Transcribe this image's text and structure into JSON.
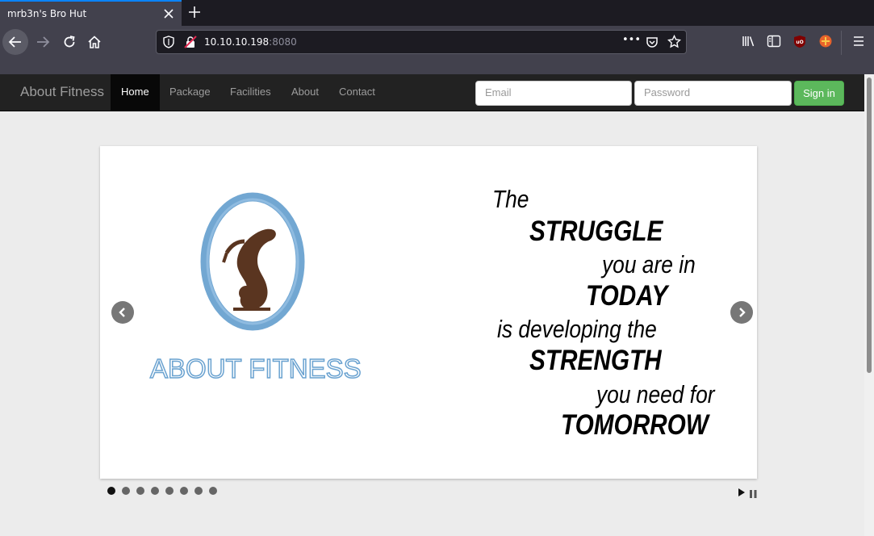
{
  "browser": {
    "tab_title": "mrb3n's Bro Hut",
    "url_host": "10.10.10.198",
    "url_port": ":8080",
    "url_more": "•••"
  },
  "site": {
    "brand": "About Fitness",
    "menu": [
      {
        "label": "Home",
        "active": true
      },
      {
        "label": "Package"
      },
      {
        "label": "Facilities"
      },
      {
        "label": "About"
      },
      {
        "label": "Contact"
      }
    ],
    "email_placeholder": "Email",
    "password_placeholder": "Password",
    "signin_label": "Sign in"
  },
  "slide": {
    "logo_text": "ABOUT FITNESS",
    "quote": [
      "The",
      "STRUGGLE",
      "you are in",
      "TODAY",
      "is developing the",
      "STRENGTH",
      "you need for",
      "TOMORROW"
    ],
    "dot_count": 8,
    "active_dot": 1
  },
  "colors": {
    "accent": "#0a84ff",
    "signin_green": "#5cb85c",
    "logo_blue": "#6aa2d0",
    "logo_brown": "#5a3520"
  }
}
